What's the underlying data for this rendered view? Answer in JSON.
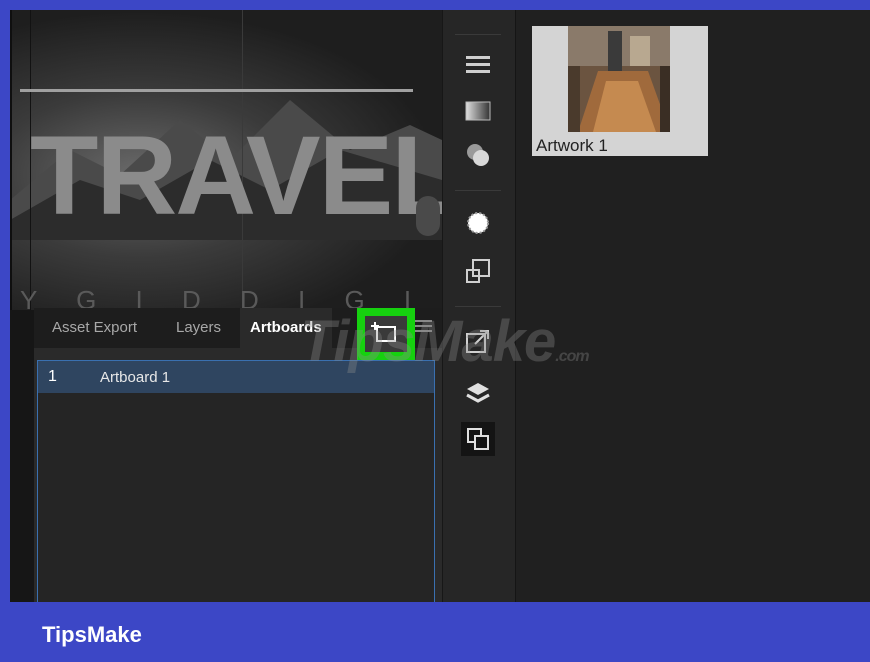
{
  "canvas": {
    "headline": "TRAVEL",
    "subline": "Y G I D D I G I D A"
  },
  "panel": {
    "tabs": [
      "Asset Export",
      "Layers",
      "Artboards"
    ],
    "more_label": ">>",
    "active_tab": "Artboards",
    "artboards": [
      {
        "number": "1",
        "name": "Artboard 1"
      }
    ]
  },
  "toolbar": {
    "icons": [
      "properties-icon",
      "gradient-icon",
      "appearance-icon",
      "brush-icon",
      "transform-icon",
      "export-icon",
      "layers-icon",
      "artboards-icon"
    ]
  },
  "assets": {
    "items": [
      {
        "label": "Artwork 1"
      }
    ]
  },
  "watermark": {
    "text": "TipsMake",
    "suffix": ".com"
  },
  "footer": {
    "brand": "TipsMake"
  },
  "colors": {
    "frame_blue": "#3c47c6",
    "highlight_green": "#16d10f",
    "selection_blue": "#3a70b0"
  }
}
